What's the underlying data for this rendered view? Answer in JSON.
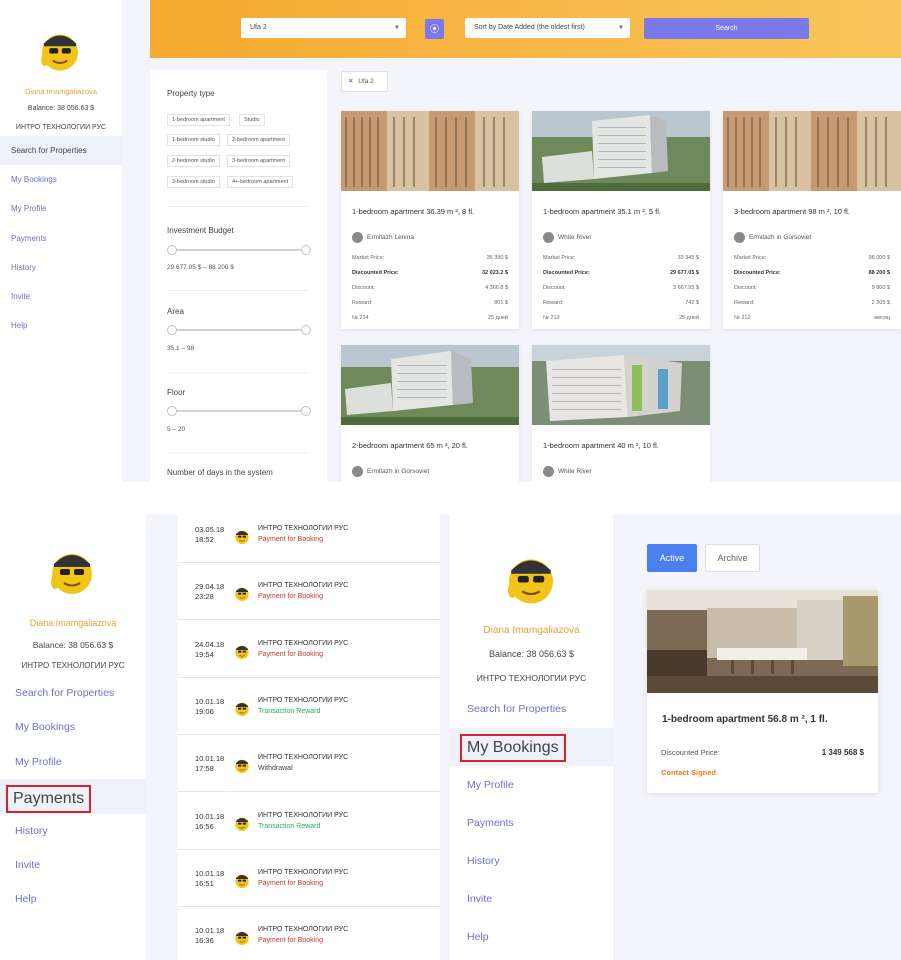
{
  "user": {
    "name": "Diana Imamgaliazova",
    "balance": "Balance: 38 056.63 $",
    "company": "ИНТРО ТЕХНОЛОГИИ РУС"
  },
  "nav": [
    {
      "label": "Search for Properties"
    },
    {
      "label": "My Bookings"
    },
    {
      "label": "My Profile"
    },
    {
      "label": "Payments"
    },
    {
      "label": "History"
    },
    {
      "label": "Invite"
    },
    {
      "label": "Help"
    }
  ],
  "search": {
    "city": "Ufa 2",
    "sort": "Sort by Date Added (the oldest first)",
    "button": "Search",
    "active_chip": "Ufa 2"
  },
  "filters": {
    "property_type_title": "Property type",
    "property_types": [
      "1-bedroom apartment",
      "Studio",
      "1-bedroom studio",
      "2-bedroom apartment",
      "2-bedroom studio",
      "3-bedroom apartment",
      "3-bedroom studio",
      "4+-bedroom apartment"
    ],
    "budget_title": "Investment Budget",
    "budget_range": "29 677.05 $ – 88 200 $",
    "area_title": "Area",
    "area_range": "35.1 – 98",
    "floor_title": "Floor",
    "floor_range": "5 – 20",
    "days_title": "Number of days in the system"
  },
  "labels": {
    "market_price": "Market Price:",
    "discounted_price": "Discounted Price:",
    "discount": "Discount:",
    "reward": "Reward:"
  },
  "listings": [
    {
      "title": "1-bedroom apartment 36.39 m ², 8 fl.",
      "developer": "Ermitazh Lenina",
      "market_price": "36 390 $",
      "discounted_price": "32 023.2 $",
      "discount": "4 366.8 $",
      "reward": "801 $",
      "number": "№ 214",
      "days": "25 дней",
      "image": "tower"
    },
    {
      "title": "1-bedroom apartment 35.1 m ², 5 fl.",
      "developer": "White River",
      "market_price": "33 345 $",
      "discounted_price": "29 677.05 $",
      "discount": "3 667.95 $",
      "reward": "742 $",
      "number": "№ 213",
      "days": "25 дней",
      "image": "complex"
    },
    {
      "title": "3-bedroom apartment 98 m ², 10 fl.",
      "developer": "Ermitazh in Gorsoviet",
      "market_price": "98 000 $",
      "discounted_price": "88 200 $",
      "discount": "9 800 $",
      "reward": "2 205 $",
      "number": "№ 212",
      "days": "месяц",
      "image": "tower"
    },
    {
      "title": "2-bedroom apartment 65 m ², 20 fl.",
      "developer": "Ermitazh in Gorsoviet",
      "image": "complex"
    },
    {
      "title": "1-bedroom apartment 40 m ², 10 fl.",
      "developer": "White River",
      "image": "block"
    }
  ],
  "payments": [
    {
      "date": "03.05.18",
      "time": "18:52",
      "company": "ИНТРО ТЕХНОЛОГИИ РУС",
      "type": "Payment for Booking",
      "kind": "booking"
    },
    {
      "date": "29.04.18",
      "time": "23:28",
      "company": "ИНТРО ТЕХНОЛОГИИ РУС",
      "type": "Payment for Booking",
      "kind": "booking"
    },
    {
      "date": "24.04.18",
      "time": "19:54",
      "company": "ИНТРО ТЕХНОЛОГИИ РУС",
      "type": "Payment for Booking",
      "kind": "booking"
    },
    {
      "date": "10.01.18",
      "time": "19:06",
      "company": "ИНТРО ТЕХНОЛОГИИ РУС",
      "type": "Transaction Reward",
      "kind": "reward"
    },
    {
      "date": "10.01.18",
      "time": "17:58",
      "company": "ИНТРО ТЕХНОЛОГИИ РУС",
      "type": "Withdrawal",
      "kind": "withdrawal"
    },
    {
      "date": "10.01.18",
      "time": "16:56",
      "company": "ИНТРО ТЕХНОЛОГИИ РУС",
      "type": "Transaction Reward",
      "kind": "reward"
    },
    {
      "date": "10.01.18",
      "time": "16:51",
      "company": "ИНТРО ТЕХНОЛОГИИ РУС",
      "type": "Payment for Booking",
      "kind": "booking"
    },
    {
      "date": "10.01.18",
      "time": "16:36",
      "company": "ИНТРО ТЕХНОЛОГИИ РУС",
      "type": "Payment for Booking",
      "kind": "booking"
    }
  ],
  "bookings": {
    "tab_active": "Active",
    "tab_archive": "Archive",
    "item": {
      "title": "1-bedroom apartment 56.8 m ², 1 fl.",
      "price_label": "Discounted Price:",
      "price": "1 349 568 $",
      "status": "Contact Signed"
    }
  },
  "colors": {
    "accent": "#7b78e8",
    "user_name": "#e6a23c",
    "nav_link": "#6f6fc8",
    "highlight_border": "#d2262f",
    "booking_payment": "#c0392b",
    "reward": "#27ae60",
    "active_tab": "#4a7ff0",
    "contract_status": "#e67e22"
  }
}
